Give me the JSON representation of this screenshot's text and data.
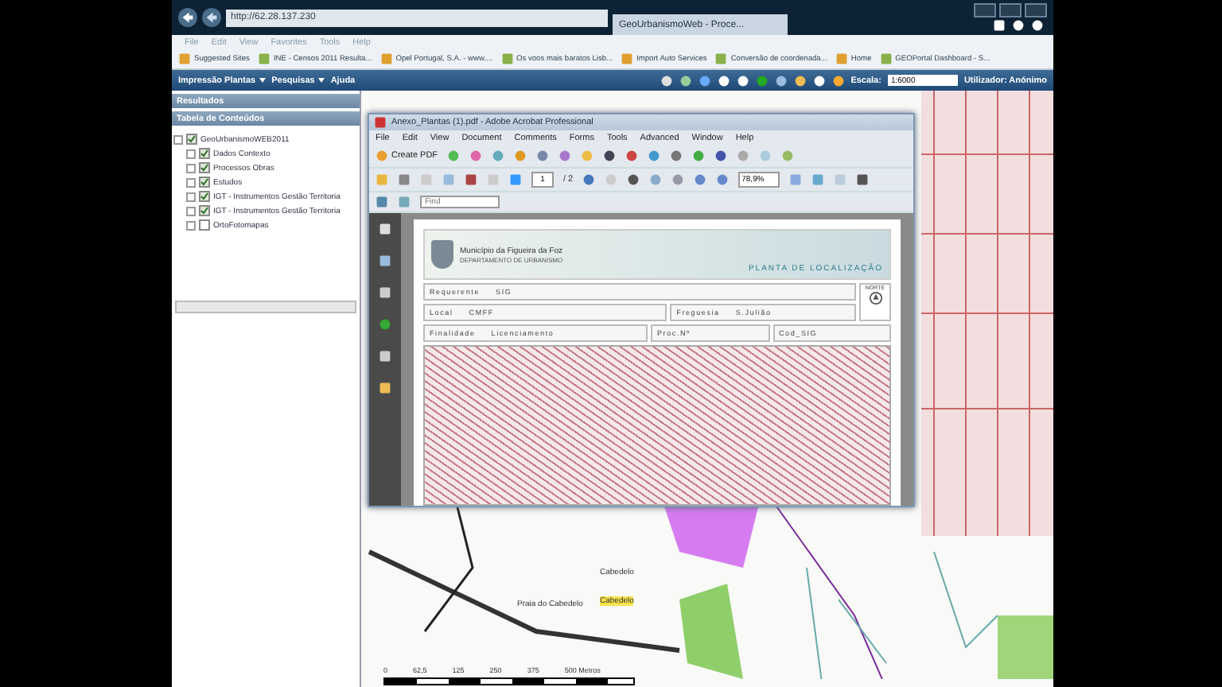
{
  "browser": {
    "address": "http://62.28.137.230",
    "tab_title": "GeoUrbanismoWeb - Proce...",
    "menu": [
      "File",
      "Edit",
      "View",
      "Favorites",
      "Tools",
      "Help"
    ],
    "favorites": [
      "Suggested Sites",
      "INE - Censos 2011 Resulta...",
      "Opel Portugal, S.A. - www....",
      "Os voos mais baratos Lisb...",
      "Import Auto Services",
      "Conversão de coordenada...",
      "Home",
      "GEOPortal Dashboard - S..."
    ]
  },
  "app": {
    "menus": [
      "Impressão Plantas",
      "Pesquisas",
      "Ajuda"
    ],
    "scale_label": "Escala:",
    "scale_value": "1:6000",
    "user": "Utilizador: Anónimo"
  },
  "sidebar": {
    "results_title": "Resultados",
    "toc_title": "Tabela de Conteúdos",
    "tree": [
      {
        "label": "GeoUrbanismoWEB2011",
        "checked": true,
        "children": [
          {
            "label": "Dados Contexto",
            "checked": true
          },
          {
            "label": "Processos Obras",
            "checked": true
          },
          {
            "label": "Estudos",
            "checked": true
          },
          {
            "label": "IGT - Instrumentos Gestão Territoria",
            "checked": true
          },
          {
            "label": "IGT - Instrumentos Gestão Territoria",
            "checked": true
          },
          {
            "label": "OrtoFotomapas",
            "checked": false
          }
        ]
      }
    ]
  },
  "acrobat": {
    "title": "Anexo_Plantas (1).pdf - Adobe Acrobat Professional",
    "menu": [
      "File",
      "Edit",
      "View",
      "Document",
      "Comments",
      "Forms",
      "Tools",
      "Advanced",
      "Window",
      "Help"
    ],
    "create_pdf": "Create PDF",
    "page": "1",
    "page_total": "/ 2",
    "zoom": "78,9%",
    "find_placeholder": "Find",
    "document": {
      "municipality": "Município da Figueira da Foz",
      "department": "DEPARTAMENTO DE URBANISMO",
      "plan_title": "PLANTA DE LOCALIZAÇÃO",
      "north_label": "NORTE",
      "fields": [
        {
          "label": "Requerente",
          "value": "SIG"
        },
        {
          "label": "Local",
          "value": "CMFF"
        },
        {
          "label": "Freguesia",
          "value": "S.Julião"
        },
        {
          "label": "Finalidade",
          "value": "Licenciamento"
        },
        {
          "label": "Proc.Nº"
        },
        {
          "label": "Cod_SIG"
        }
      ]
    }
  },
  "map": {
    "labels": [
      "Praia do Cabedelo",
      "Cabedelo"
    ],
    "highlighted_label": "Cabedelo",
    "scale_ticks": [
      "0",
      "62,5",
      "125",
      "250",
      "375",
      "500 Metros"
    ]
  }
}
